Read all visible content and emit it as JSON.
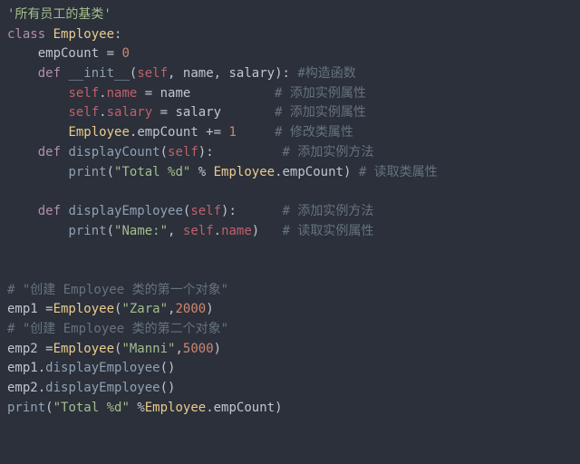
{
  "code": {
    "l01_docstring": "'所有员工的基类'",
    "l02_class_kw": "class",
    "l02_class_name": "Employee",
    "l02_colon": ":",
    "l03_indent": "    ",
    "l03_var": "empCount",
    "l03_eq": " = ",
    "l03_val": "0",
    "l04_indent": "    ",
    "l04_def": "def",
    "l04_fn": "__init__",
    "l04_sig_open": "(",
    "l04_self": "self",
    "l04_c1": ", ",
    "l04_p1": "name",
    "l04_c2": ", ",
    "l04_p2": "salary",
    "l04_sig_close": "):",
    "l04_cmt": " #构造函数",
    "l05_indent": "        ",
    "l05_self": "self",
    "l05_dot": ".",
    "l05_attr": "name",
    "l05_eq": " = ",
    "l05_rhs": "name",
    "l05_pad": "           ",
    "l05_cmt": "# 添加实例属性",
    "l06_indent": "        ",
    "l06_self": "self",
    "l06_dot": ".",
    "l06_attr": "salary",
    "l06_eq": " = ",
    "l06_rhs": "salary",
    "l06_pad": "       ",
    "l06_cmt": "# 添加实例属性",
    "l07_indent": "        ",
    "l07_cls": "Employee",
    "l07_dot": ".",
    "l07_attr": "empCount",
    "l07_op": " += ",
    "l07_val": "1",
    "l07_pad": "     ",
    "l07_cmt": "# 修改类属性",
    "l08_indent": "    ",
    "l08_def": "def",
    "l08_fn": "displayCount",
    "l08_sig": "(",
    "l08_self": "self",
    "l08_close": "):",
    "l08_pad": "         ",
    "l08_cmt": "# 添加实例方法",
    "l09_indent": "        ",
    "l09_print": "print",
    "l09_open": "(",
    "l09_str": "\"Total %d\"",
    "l09_mod": " % ",
    "l09_cls": "Employee",
    "l09_dot": ".",
    "l09_attr": "empCount",
    "l09_close": ")",
    "l09_pad": " ",
    "l09_cmt": "# 读取类属性",
    "l11_indent": "    ",
    "l11_def": "def",
    "l11_fn": "displayEmployee",
    "l11_sig": "(",
    "l11_self": "self",
    "l11_close": "):",
    "l11_pad": "      ",
    "l11_cmt": "# 添加实例方法",
    "l12_indent": "        ",
    "l12_print": "print",
    "l12_open": "(",
    "l12_str": "\"Name:\"",
    "l12_c": ", ",
    "l12_self": "self",
    "l12_dot": ".",
    "l12_attr": "name",
    "l12_close": ")",
    "l12_pad": "   ",
    "l12_cmt": "# 读取实例属性",
    "l15_cmt": "# \"创建 Employee 类的第一个对象\"",
    "l16_var": "emp1",
    "l16_eq": " =",
    "l16_cls": "Employee",
    "l16_open": "(",
    "l16_str": "\"Zara\"",
    "l16_c": ",",
    "l16_num": "2000",
    "l16_close": ")",
    "l17_cmt": "# \"创建 Employee 类的第二个对象\"",
    "l18_var": "emp2",
    "l18_eq": " =",
    "l18_cls": "Employee",
    "l18_open": "(",
    "l18_str": "\"Manni\"",
    "l18_c": ",",
    "l18_num": "5000",
    "l18_close": ")",
    "l19_var": "emp1",
    "l19_dot": ".",
    "l19_fn": "displayEmployee",
    "l19_par": "()",
    "l20_var": "emp2",
    "l20_dot": ".",
    "l20_fn": "displayEmployee",
    "l20_par": "()",
    "l21_print": "print",
    "l21_open": "(",
    "l21_str": "\"Total %d\"",
    "l21_mod": " %",
    "l21_cls": "Employee",
    "l21_dot": ".",
    "l21_attr": "empCount",
    "l21_close": ")"
  }
}
